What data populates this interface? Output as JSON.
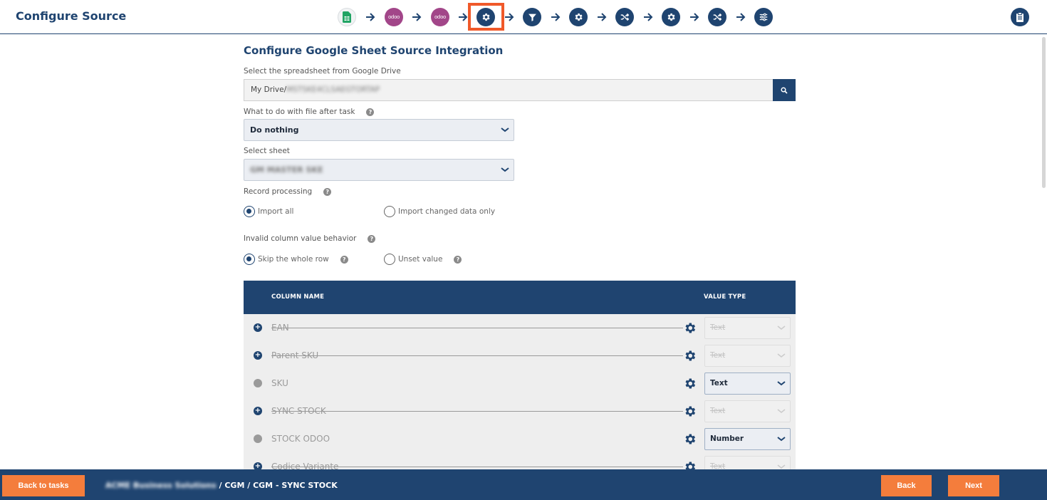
{
  "header": {
    "title": "Configure Source",
    "steps": [
      {
        "name": "google-sheets-step",
        "icon": "google-sheets-icon"
      },
      {
        "name": "odoo-step-1",
        "icon": "odoo-logo",
        "text": "odoo"
      },
      {
        "name": "odoo-step-2",
        "icon": "odoo-logo",
        "text": "odoo"
      },
      {
        "name": "configure-source-step",
        "icon": "gear-icon",
        "active": true
      },
      {
        "name": "filter-step",
        "icon": "filter-icon"
      },
      {
        "name": "settings-step-1",
        "icon": "gear-icon"
      },
      {
        "name": "shuffle-step-1",
        "icon": "shuffle-icon"
      },
      {
        "name": "settings-step-2",
        "icon": "gear-icon"
      },
      {
        "name": "shuffle-step-2",
        "icon": "shuffle-icon"
      },
      {
        "name": "mapping-step",
        "icon": "sliders-icon"
      }
    ],
    "right_icon": "clipboard-icon"
  },
  "form": {
    "title": "Configure Google Sheet Source Integration",
    "drive_label": "Select the spreadsheet from Google Drive",
    "drive_prefix": "My Drive/",
    "drive_blurred": "MSTSKE4CLSAEGTORTAP",
    "after_task_label": "What to do with file after task",
    "after_task_value": "Do nothing",
    "sheet_label": "Select sheet",
    "sheet_blurred": "GM MASTER SKE",
    "record_processing_label": "Record processing",
    "record_options": [
      {
        "label": "Import all",
        "selected": true
      },
      {
        "label": "Import changed data only",
        "selected": false
      }
    ],
    "invalid_label": "Invalid column value behavior",
    "invalid_options": [
      {
        "label": "Skip the whole row",
        "selected": true
      },
      {
        "label": "Unset value",
        "selected": false
      }
    ]
  },
  "table": {
    "col_name_header": "COLUMN NAME",
    "value_type_header": "VALUE TYPE",
    "rows": [
      {
        "name": "EAN",
        "enabled": false,
        "value_type": "Text"
      },
      {
        "name": "Parent SKU",
        "enabled": false,
        "value_type": "Text"
      },
      {
        "name": "SKU",
        "enabled": true,
        "value_type": "Text"
      },
      {
        "name": "SYNC STOCK",
        "enabled": false,
        "value_type": "Text"
      },
      {
        "name": "STOCK ODOO",
        "enabled": true,
        "value_type": "Number"
      },
      {
        "name": "Codice Variante",
        "enabled": false,
        "value_type": "Text"
      }
    ]
  },
  "footer": {
    "back_to_tasks": "Back to tasks",
    "breadcrumb_blurred": "ACME Business Solutions",
    "breadcrumb_rest": " / CGM / CGM - SYNC STOCK",
    "back": "Back",
    "next": "Next"
  },
  "colors": {
    "primary": "#1f4470",
    "accent": "#f47d3c",
    "highlight": "#f0592a",
    "odoo": "#a24689"
  }
}
